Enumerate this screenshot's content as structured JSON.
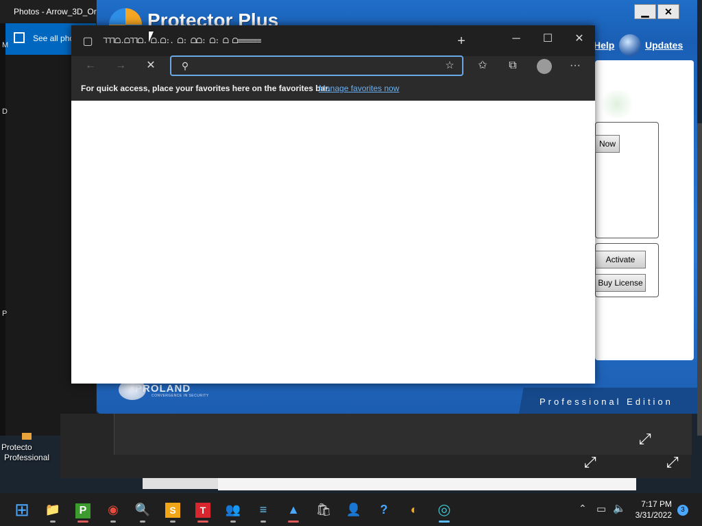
{
  "photos_window": {
    "title": "Photos - Arrow_3D_Or",
    "see_all": "See all pho"
  },
  "protector": {
    "brand": "Protector Plus",
    "minimize": "▁",
    "close": "✕",
    "help": "Help",
    "updates": "Updates",
    "button_now": "Now",
    "button_activate": "Activate",
    "button_buy_license": "Buy License",
    "proland": "PROLAND",
    "tagline": "CONVERGENCE IN SECURITY",
    "edition": "Professional Edition"
  },
  "browser": {
    "tab_garbled": "ᒣᒣᒣᗝ.ᗝᒣᒣᗝ. ᗝ.ᗝ:. ᗝ: ᗝᗝ: ᗝ: ᗝ  ᗝ≡≡≡≡≡≡",
    "new_tab": "+",
    "address_placeholder": "",
    "favorites_bar_text": "For quick access, place your favorites here on the favorites bar.",
    "manage_favorites": "Manage favorites now"
  },
  "desktop": {
    "icon_label_line1": "Protecto",
    "icon_label_line2": "Professional",
    "side_letters": [
      "M",
      "D",
      "P"
    ]
  },
  "taskbar": {
    "time": "7:17 PM",
    "date": "3/31/2022",
    "notification_count": "3",
    "apps": [
      {
        "name": "start",
        "glyph": "⊞"
      },
      {
        "name": "file-explorer",
        "glyph": "📁"
      },
      {
        "name": "protector-plus-p",
        "glyph": "P"
      },
      {
        "name": "chrome",
        "glyph": "◉"
      },
      {
        "name": "control-panel",
        "glyph": "🔍"
      },
      {
        "name": "app-s",
        "glyph": "S"
      },
      {
        "name": "app-t",
        "glyph": "T"
      },
      {
        "name": "people",
        "glyph": "👥"
      },
      {
        "name": "notepad",
        "glyph": "≡"
      },
      {
        "name": "photos",
        "glyph": "▲"
      },
      {
        "name": "store",
        "glyph": "🛍"
      },
      {
        "name": "people-2",
        "glyph": "👤"
      },
      {
        "name": "help",
        "glyph": "?"
      },
      {
        "name": "protector-tray",
        "glyph": "◐"
      },
      {
        "name": "edge",
        "glyph": "◎"
      }
    ]
  },
  "colors": {
    "accent": "#0067c0",
    "link": "#6ab0f3",
    "protector_blue": "#1f6ec8"
  }
}
